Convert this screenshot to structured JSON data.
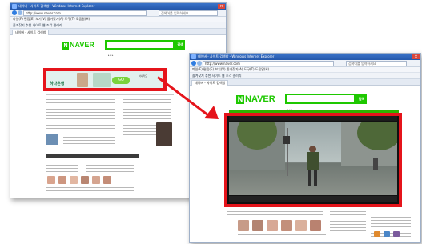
{
  "left_window": {
    "title": "네이버 - 사이트 검색창 - Windows Internet Explorer",
    "address": "http://www.naver.com",
    "search_placeholder": "검색어를 입력하세요",
    "menu": "파일(F)  편집(E)  보기(V)  즐겨찾기(A)  도구(T)  도움말(H)",
    "favorites": "즐겨찾기  추천 사이트  웹 조각 갤러리",
    "tab": "네이버 - 사이트 검색창",
    "logo": "NAVER",
    "search_btn": "검색",
    "ad_headline": "하나은행",
    "ad_subtext": "GO",
    "ad_side": "하나카드"
  },
  "right_window": {
    "title": "네이버 - 사이트 검색창 - Windows Internet Explorer",
    "address": "http://www.naver.com",
    "search_placeholder": "검색어를 입력하세요",
    "menu": "파일(F)  편집(E)  보기(V)  즐겨찾기(A)  도구(T)  도움말(H)",
    "favorites": "즐겨찾기  추천 사이트  웹 조각 갤러리",
    "tab": "네이버 - 사이트 검색창",
    "logo": "NAVER",
    "search_btn": "검색"
  },
  "colors": {
    "naver_green": "#1ec800",
    "highlight_red": "#e5141b"
  }
}
